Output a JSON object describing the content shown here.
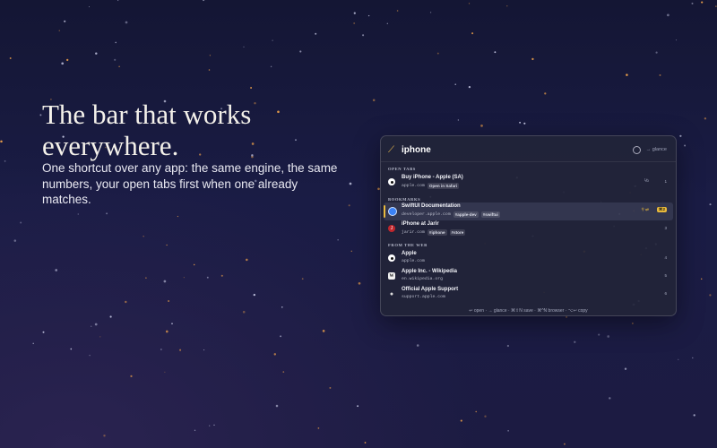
{
  "hero": {
    "title": "The bar that works everywhere.",
    "subtitle": "One shortcut over any app: the same engine, the same numbers, your open tabs first when one already matches."
  },
  "launcher": {
    "query": "iphone",
    "glance_hint": "→ glance",
    "sections": [
      {
        "label": "OPEN TABS"
      },
      {
        "label": "BOOKMARKS"
      },
      {
        "label": "FROM THE WEB"
      }
    ],
    "results": [
      {
        "title": "Buy iPhone - Apple (SA)",
        "url": "apple.com",
        "tags": [
          "Open in Safari"
        ],
        "extra": "⅟b",
        "shortcut": "1",
        "icon": "safari-tab-icon"
      },
      {
        "title": "SwiftUI Documentation",
        "url": "developer.apple.com",
        "tags": [
          "#apple-dev",
          "#swiftui"
        ],
        "extra": "⚲ ⇄",
        "shortcut": "⌘2",
        "icon": "swift-icon",
        "selected": true
      },
      {
        "title": "iPhone at Jarir",
        "url": "jarir.com",
        "tags": [
          "#iphone",
          "#store"
        ],
        "extra": "",
        "shortcut": "3",
        "icon": "jarir-icon"
      },
      {
        "title": "Apple",
        "url": "apple.com",
        "tags": [],
        "extra": "",
        "shortcut": "4",
        "icon": "apple-icon"
      },
      {
        "title": "Apple Inc. - Wikipedia",
        "url": "en.wikipedia.org",
        "tags": [],
        "extra": "",
        "shortcut": "5",
        "icon": "wikipedia-icon"
      },
      {
        "title": "Official Apple Support",
        "url": "support.apple.com",
        "tags": [],
        "extra": "",
        "shortcut": "6",
        "icon": "apple-support-icon"
      }
    ],
    "footer": "↩ open · → glance · ⌘⇧N save · ⌘^N browser · ⌥↩ copy"
  },
  "colors": {
    "accent": "#e8b93c",
    "panel_bg": "#222438",
    "background_top": "#141634",
    "background_bottom": "#1c1b42"
  }
}
